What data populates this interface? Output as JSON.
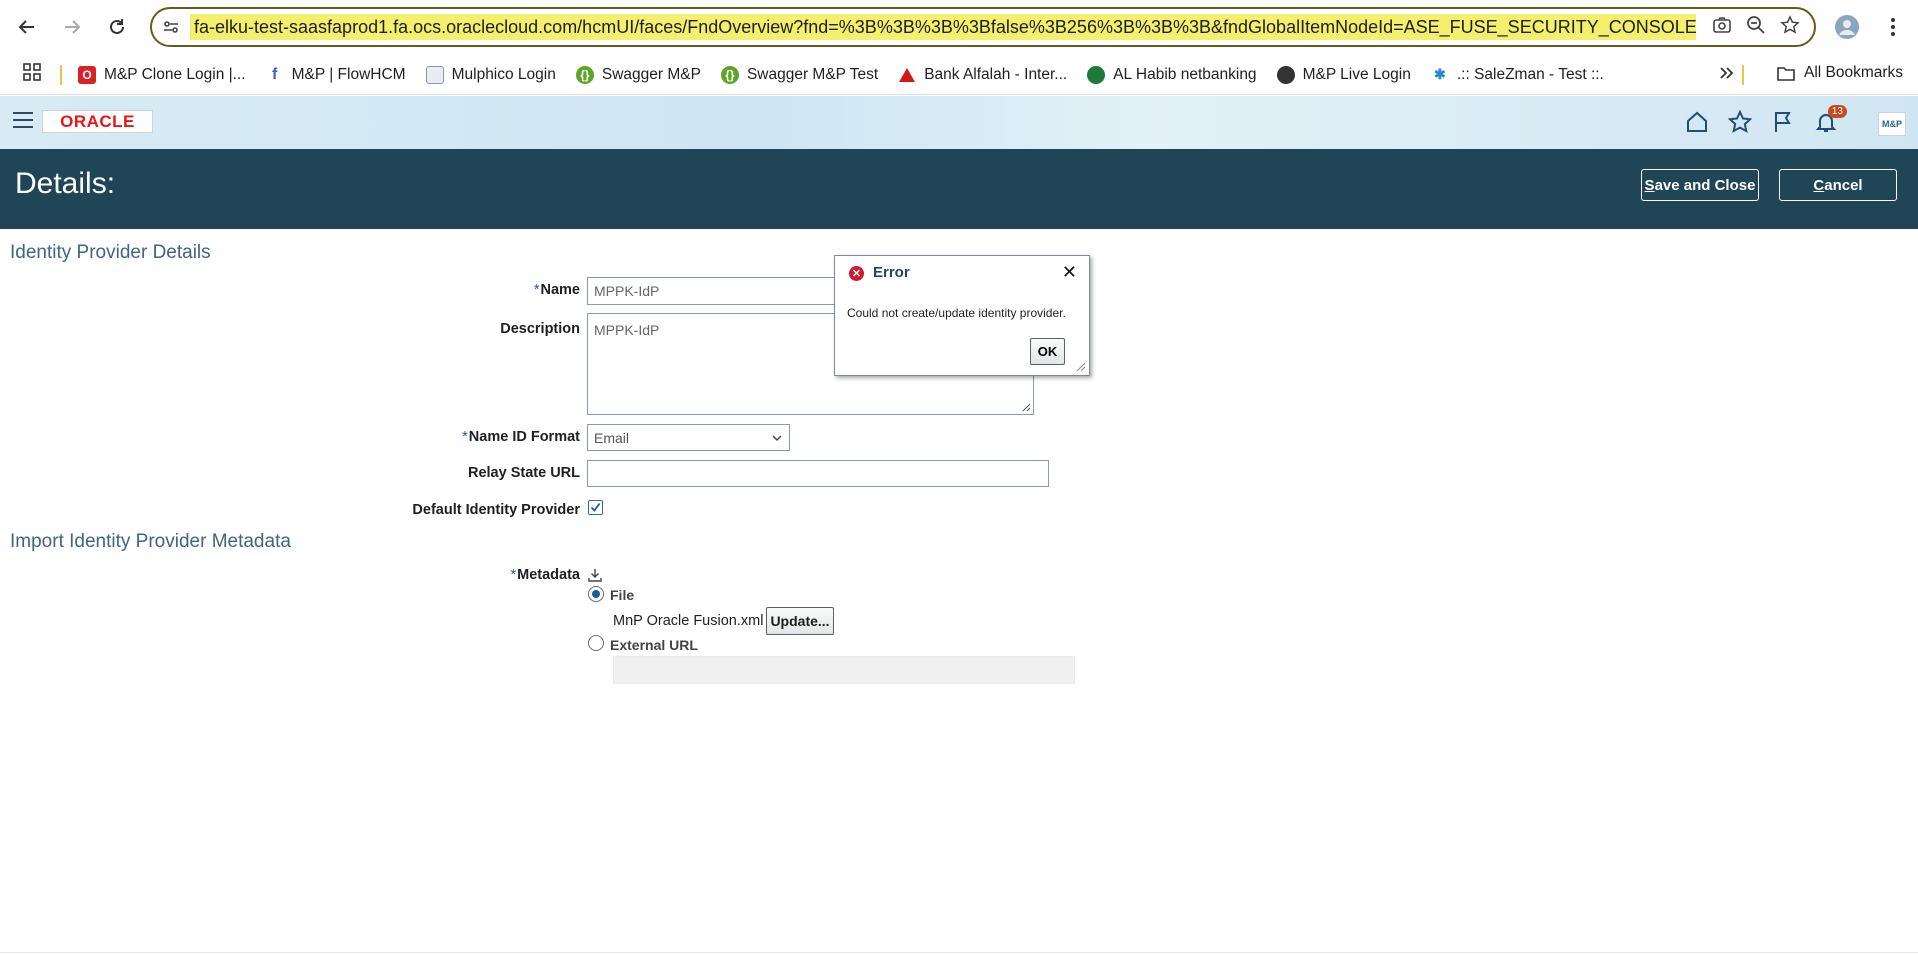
{
  "browser": {
    "url": "fa-elku-test-saasfaprod1.fa.ocs.oraclecloud.com/hcmUI/faces/FndOverview?fnd=%3B%3B%3B%3Bfalse%3B256%3B%3B%3B&fndGlobalItemNodeId=ASE_FUSE_SECURITY_CONSOLE&_afrLoop=",
    "bookmarks": [
      {
        "label": "M&P Clone Login |...",
        "icon": "oracle-o-icon",
        "color": "#d8222a"
      },
      {
        "label": "M&P | FlowHCM",
        "icon": "flow-f-icon",
        "color": "#3a63b8"
      },
      {
        "label": "Mulphico Login",
        "icon": "page-icon",
        "color": "#5d6b8a"
      },
      {
        "label": "Swagger M&P",
        "icon": "swagger-icon",
        "color": "#5ea42a"
      },
      {
        "label": "Swagger M&P Test",
        "icon": "swagger-icon",
        "color": "#5ea42a"
      },
      {
        "label": "Bank Alfalah - Inter...",
        "icon": "alfalah-icon",
        "color": "#d01a1a"
      },
      {
        "label": "AL Habib netbanking",
        "icon": "habib-icon",
        "color": "#1e7a3a"
      },
      {
        "label": "M&P Live Login",
        "icon": "globe-icon",
        "color": "#333333"
      },
      {
        "label": ".:: SaleZman - Test ::.",
        "icon": "salezman-icon",
        "color": "#2a88c8"
      }
    ],
    "all_bookmarks_label": "All Bookmarks"
  },
  "header": {
    "logo_text": "ORACLE",
    "notification_count": "13",
    "avatar_text": "M&P"
  },
  "titlebar": {
    "title": "Details:",
    "save_close_prefix": "S",
    "save_close_rest": "ave and Close",
    "cancel_prefix": "C",
    "cancel_rest": "ancel"
  },
  "idp_section": {
    "heading": "Identity Provider Details",
    "name_label": "Name",
    "name_value": "MPPK-IdP",
    "description_label": "Description",
    "description_value": "MPPK-IdP",
    "name_id_format_label": "Name ID Format",
    "name_id_format_value": "Email",
    "relay_state_label": "Relay State URL",
    "relay_state_value": "",
    "default_idp_label": "Default Identity Provider",
    "default_idp_checked": true
  },
  "metadata_section": {
    "heading": "Import Identity Provider Metadata",
    "metadata_label": "Metadata",
    "file_option": "File",
    "file_name": "MnP Oracle Fusion.xml",
    "update_button": "Update...",
    "external_url_option": "External URL",
    "selected": "File"
  },
  "dialog": {
    "title": "Error",
    "message": "Could not create/update identity provider.",
    "ok_label": "OK"
  },
  "colors": {
    "titlebar_bg": "#1f4556",
    "section_heading": "#3f6680",
    "error_red": "#d01b2a",
    "url_highlight": "#f4ef6c"
  }
}
